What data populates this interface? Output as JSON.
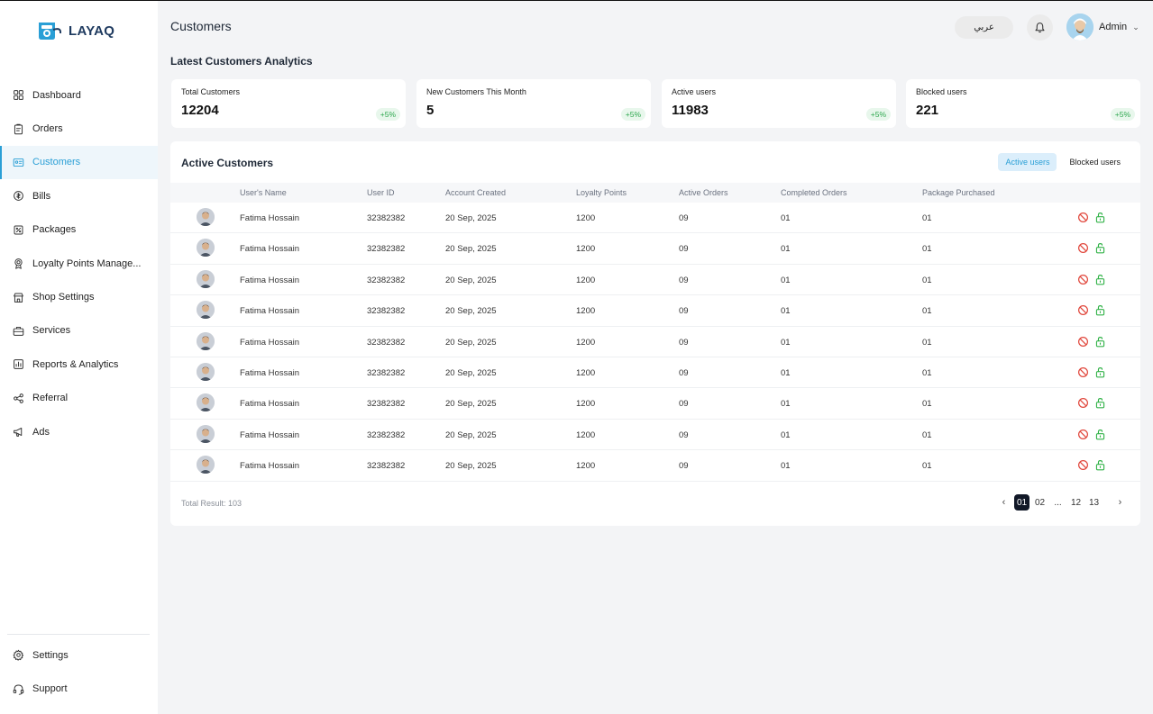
{
  "app": {
    "logo_text": "LAYAQ"
  },
  "sidebar": {
    "items": [
      {
        "label": "Dashboard",
        "icon": "grid-icon"
      },
      {
        "label": "Orders",
        "icon": "clipboard-icon"
      },
      {
        "label": "Customers",
        "icon": "id-card-icon"
      },
      {
        "label": "Bills",
        "icon": "coin-icon"
      },
      {
        "label": "Packages",
        "icon": "percent-tag-icon"
      },
      {
        "label": "Loyalty Points Manage...",
        "icon": "medal-icon"
      },
      {
        "label": "Shop Settings",
        "icon": "store-icon"
      },
      {
        "label": "Services",
        "icon": "briefcase-icon"
      },
      {
        "label": "Reports & Analytics",
        "icon": "chart-icon"
      },
      {
        "label": "Referral",
        "icon": "share-icon"
      },
      {
        "label": "Ads",
        "icon": "megaphone-icon"
      }
    ],
    "active_index": 2,
    "bottom_items": [
      {
        "label": "Settings",
        "icon": "gear-icon"
      },
      {
        "label": "Support",
        "icon": "headset-icon"
      }
    ]
  },
  "header": {
    "title": "Customers",
    "lang_button": "عربي",
    "user_name": "Admin"
  },
  "analytics": {
    "title": "Latest Customers Analytics",
    "cards": [
      {
        "label": "Total Customers",
        "value": "12204",
        "change": "+5%"
      },
      {
        "label": "New Customers This Month",
        "value": "5",
        "change": "+5%"
      },
      {
        "label": "Active users",
        "value": "11983",
        "change": "+5%"
      },
      {
        "label": "Blocked users",
        "value": "221",
        "change": "+5%"
      }
    ]
  },
  "table": {
    "title": "Active Customers",
    "filters": [
      "Active users",
      "Blocked users"
    ],
    "active_filter": "Active users",
    "columns": [
      "User's Name",
      "User ID",
      "Account Created",
      "Loyalty Points",
      "Active Orders",
      "Completed Orders",
      "Package Purchased"
    ],
    "rows": [
      {
        "name": "Fatima Hossain",
        "id": "32382382",
        "created": "20 Sep, 2025",
        "points": "1200",
        "active": "09",
        "completed": "01",
        "package": "01"
      },
      {
        "name": "Fatima Hossain",
        "id": "32382382",
        "created": "20 Sep, 2025",
        "points": "1200",
        "active": "09",
        "completed": "01",
        "package": "01"
      },
      {
        "name": "Fatima Hossain",
        "id": "32382382",
        "created": "20 Sep, 2025",
        "points": "1200",
        "active": "09",
        "completed": "01",
        "package": "01"
      },
      {
        "name": "Fatima Hossain",
        "id": "32382382",
        "created": "20 Sep, 2025",
        "points": "1200",
        "active": "09",
        "completed": "01",
        "package": "01"
      },
      {
        "name": "Fatima Hossain",
        "id": "32382382",
        "created": "20 Sep, 2025",
        "points": "1200",
        "active": "09",
        "completed": "01",
        "package": "01"
      },
      {
        "name": "Fatima Hossain",
        "id": "32382382",
        "created": "20 Sep, 2025",
        "points": "1200",
        "active": "09",
        "completed": "01",
        "package": "01"
      },
      {
        "name": "Fatima Hossain",
        "id": "32382382",
        "created": "20 Sep, 2025",
        "points": "1200",
        "active": "09",
        "completed": "01",
        "package": "01"
      },
      {
        "name": "Fatima Hossain",
        "id": "32382382",
        "created": "20 Sep, 2025",
        "points": "1200",
        "active": "09",
        "completed": "01",
        "package": "01"
      },
      {
        "name": "Fatima Hossain",
        "id": "32382382",
        "created": "20 Sep, 2025",
        "points": "1200",
        "active": "09",
        "completed": "01",
        "package": "01"
      }
    ],
    "total_result": "Total Result: 103",
    "pagination": {
      "prev": "‹",
      "pages": [
        "01",
        "02",
        "...",
        "12",
        "13"
      ],
      "current": "01",
      "next": "›"
    }
  },
  "colors": {
    "accent": "#2a9fd6",
    "positive": "#2fa84f",
    "block": "#e0453a",
    "unlock": "#34b34a",
    "page_active": "#111827"
  }
}
